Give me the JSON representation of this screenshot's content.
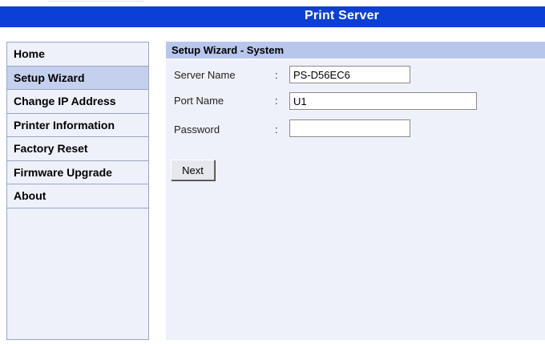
{
  "header": {
    "title": "Print Server"
  },
  "sidebar": {
    "items": [
      {
        "label": "Home"
      },
      {
        "label": "Setup Wizard"
      },
      {
        "label": "Change IP Address"
      },
      {
        "label": "Printer Information"
      },
      {
        "label": "Factory Reset"
      },
      {
        "label": "Firmware Upgrade"
      },
      {
        "label": "About"
      }
    ],
    "active_index": 1
  },
  "main": {
    "section_title": "Setup Wizard - System",
    "fields": [
      {
        "label": "Server Name",
        "colon": ":",
        "value": "PS-D56EC6"
      },
      {
        "label": "Port Name",
        "colon": ":",
        "value": "U1"
      },
      {
        "label": "Password",
        "colon": ":",
        "value": ""
      }
    ],
    "next_label": "Next"
  },
  "colors": {
    "header_bg": "#0c3fd6",
    "panel_bg": "#eef1f9",
    "section_bar_bg": "#b8c6ec",
    "active_nav_bg": "#c4d0ee"
  }
}
